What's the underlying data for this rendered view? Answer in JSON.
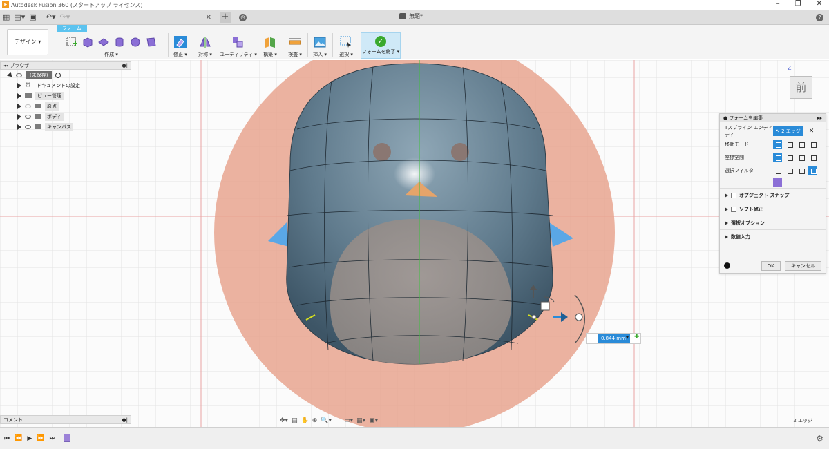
{
  "window": {
    "title": "Autodesk Fusion 360 (スタートアップ ライセンス)"
  },
  "document": {
    "tab_name": "無題*"
  },
  "toolbar": {
    "workspace": "デザイン ▾",
    "active_tab": "フォーム",
    "groups": {
      "create": "作成 ▾",
      "modify": "修正 ▾",
      "symmetry": "対称 ▾",
      "utility": "ユーティリティ ▾",
      "construct": "構築 ▾",
      "inspect": "検査 ▾",
      "insert": "挿入 ▾",
      "select": "選択 ▾",
      "finish": "フォームを終了 ▾"
    }
  },
  "browser": {
    "title": "ブラウザ",
    "root": "(未保存)",
    "items": [
      {
        "label": "ドキュメントの設定"
      },
      {
        "label": "ビュー管理"
      },
      {
        "label": "原点"
      },
      {
        "label": "ボディ"
      },
      {
        "label": "キャンバス"
      }
    ]
  },
  "form_panel": {
    "title": "フォームを編集",
    "entity_label": "Tスプライン エンティティ",
    "entity_value": "2 エッジ",
    "rows": [
      "移動モード",
      "座標空間",
      "選択フィルタ"
    ],
    "sections": [
      "オブジェクト スナップ",
      "ソフト修正",
      "選択オプション",
      "数値入力"
    ],
    "ok": "OK",
    "cancel": "キャンセル"
  },
  "viewcube": {
    "face": "前",
    "axis": "Z"
  },
  "dimension": {
    "value": "0.844 mm"
  },
  "comment": {
    "label": "コメント"
  },
  "status": {
    "selection": "2 エッジ"
  },
  "colors": {
    "accent": "#2a8bd8",
    "form_tab": "#5cc3ef",
    "canvas_bg": "#e8a58f"
  }
}
